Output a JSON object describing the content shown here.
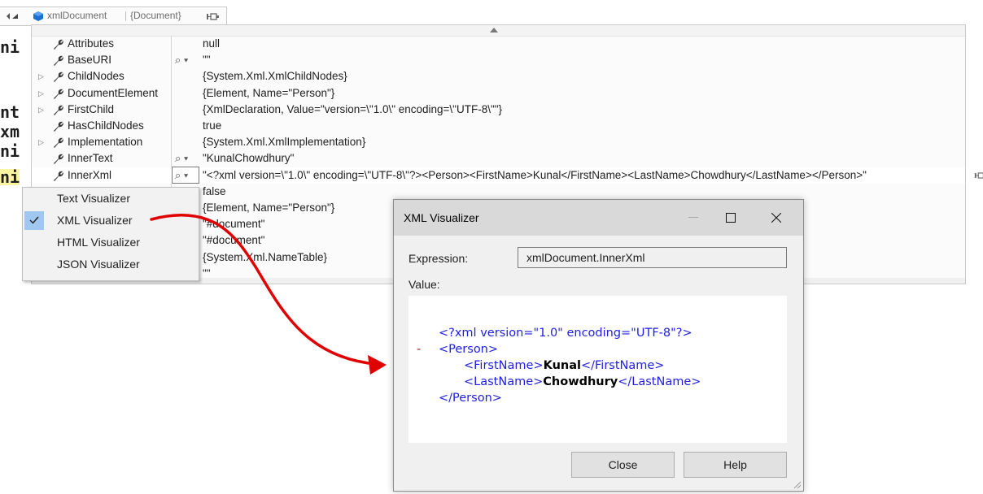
{
  "editor": {
    "fragments": [
      "ni",
      "nt",
      "xm",
      "ni",
      "ni"
    ]
  },
  "datatip": {
    "header_name": "xmlDocument",
    "header_sep": "|",
    "header_type": "{Document}",
    "rows": [
      {
        "name": "Attributes",
        "value": "null",
        "expandable": false,
        "magnifier": false
      },
      {
        "name": "BaseURI",
        "value": "\"\"",
        "expandable": false,
        "magnifier": true
      },
      {
        "name": "ChildNodes",
        "value": "{System.Xml.XmlChildNodes}",
        "expandable": true,
        "magnifier": false
      },
      {
        "name": "DocumentElement",
        "value": "{Element, Name=\"Person\"}",
        "expandable": true,
        "magnifier": false
      },
      {
        "name": "FirstChild",
        "value": "{XmlDeclaration, Value=\"version=\\\"1.0\\\" encoding=\\\"UTF-8\\\"\"}",
        "expandable": true,
        "magnifier": false
      },
      {
        "name": "HasChildNodes",
        "value": "true",
        "expandable": false,
        "magnifier": false
      },
      {
        "name": "Implementation",
        "value": "{System.Xml.XmlImplementation}",
        "expandable": true,
        "magnifier": false
      },
      {
        "name": "InnerText",
        "value": "\"KunalChowdhury\"",
        "expandable": false,
        "magnifier": true
      },
      {
        "name": "InnerXml",
        "value": "\"<?xml version=\\\"1.0\\\" encoding=\\\"UTF-8\\\"?><Person><FirstName>Kunal</FirstName><LastName>Chowdhury</LastName></Person>\"",
        "expandable": false,
        "magnifier": true,
        "selected": true
      },
      {
        "name": "",
        "value": "false"
      },
      {
        "name": "",
        "value": "{Element, Name=\"Person\"}"
      },
      {
        "name": "",
        "value": "\"#document\""
      },
      {
        "name": "",
        "value": "\"#document\""
      },
      {
        "name": "",
        "value": "{System.Xml.NameTable}"
      },
      {
        "name": "",
        "value": "\"\""
      }
    ]
  },
  "context_menu": {
    "items": [
      {
        "label": "Text Visualizer",
        "checked": false
      },
      {
        "label": "XML Visualizer",
        "checked": true
      },
      {
        "label": "HTML Visualizer",
        "checked": false
      },
      {
        "label": "JSON Visualizer",
        "checked": false
      }
    ]
  },
  "dialog": {
    "title": "XML Visualizer",
    "expression_label": "Expression:",
    "expression_value": "xmlDocument.InnerXml",
    "value_label": "Value:",
    "xml": {
      "decl": "<?xml version=\"1.0\" encoding=\"UTF-8\"?>",
      "collapse": "-",
      "person_open": "<Person>",
      "first_open": "<FirstName>",
      "first_value": "Kunal",
      "first_close": "</FirstName>",
      "last_open": "<LastName>",
      "last_value": "Chowdhury",
      "last_close": "</LastName>",
      "person_close": "</Person>"
    },
    "close_button": "Close",
    "help_button": "Help"
  },
  "colors": {
    "xml_markup": "#1e1ee6",
    "xml_tag": "#a31515",
    "arrow": "#e00000",
    "selection": "#9fc7ef"
  }
}
